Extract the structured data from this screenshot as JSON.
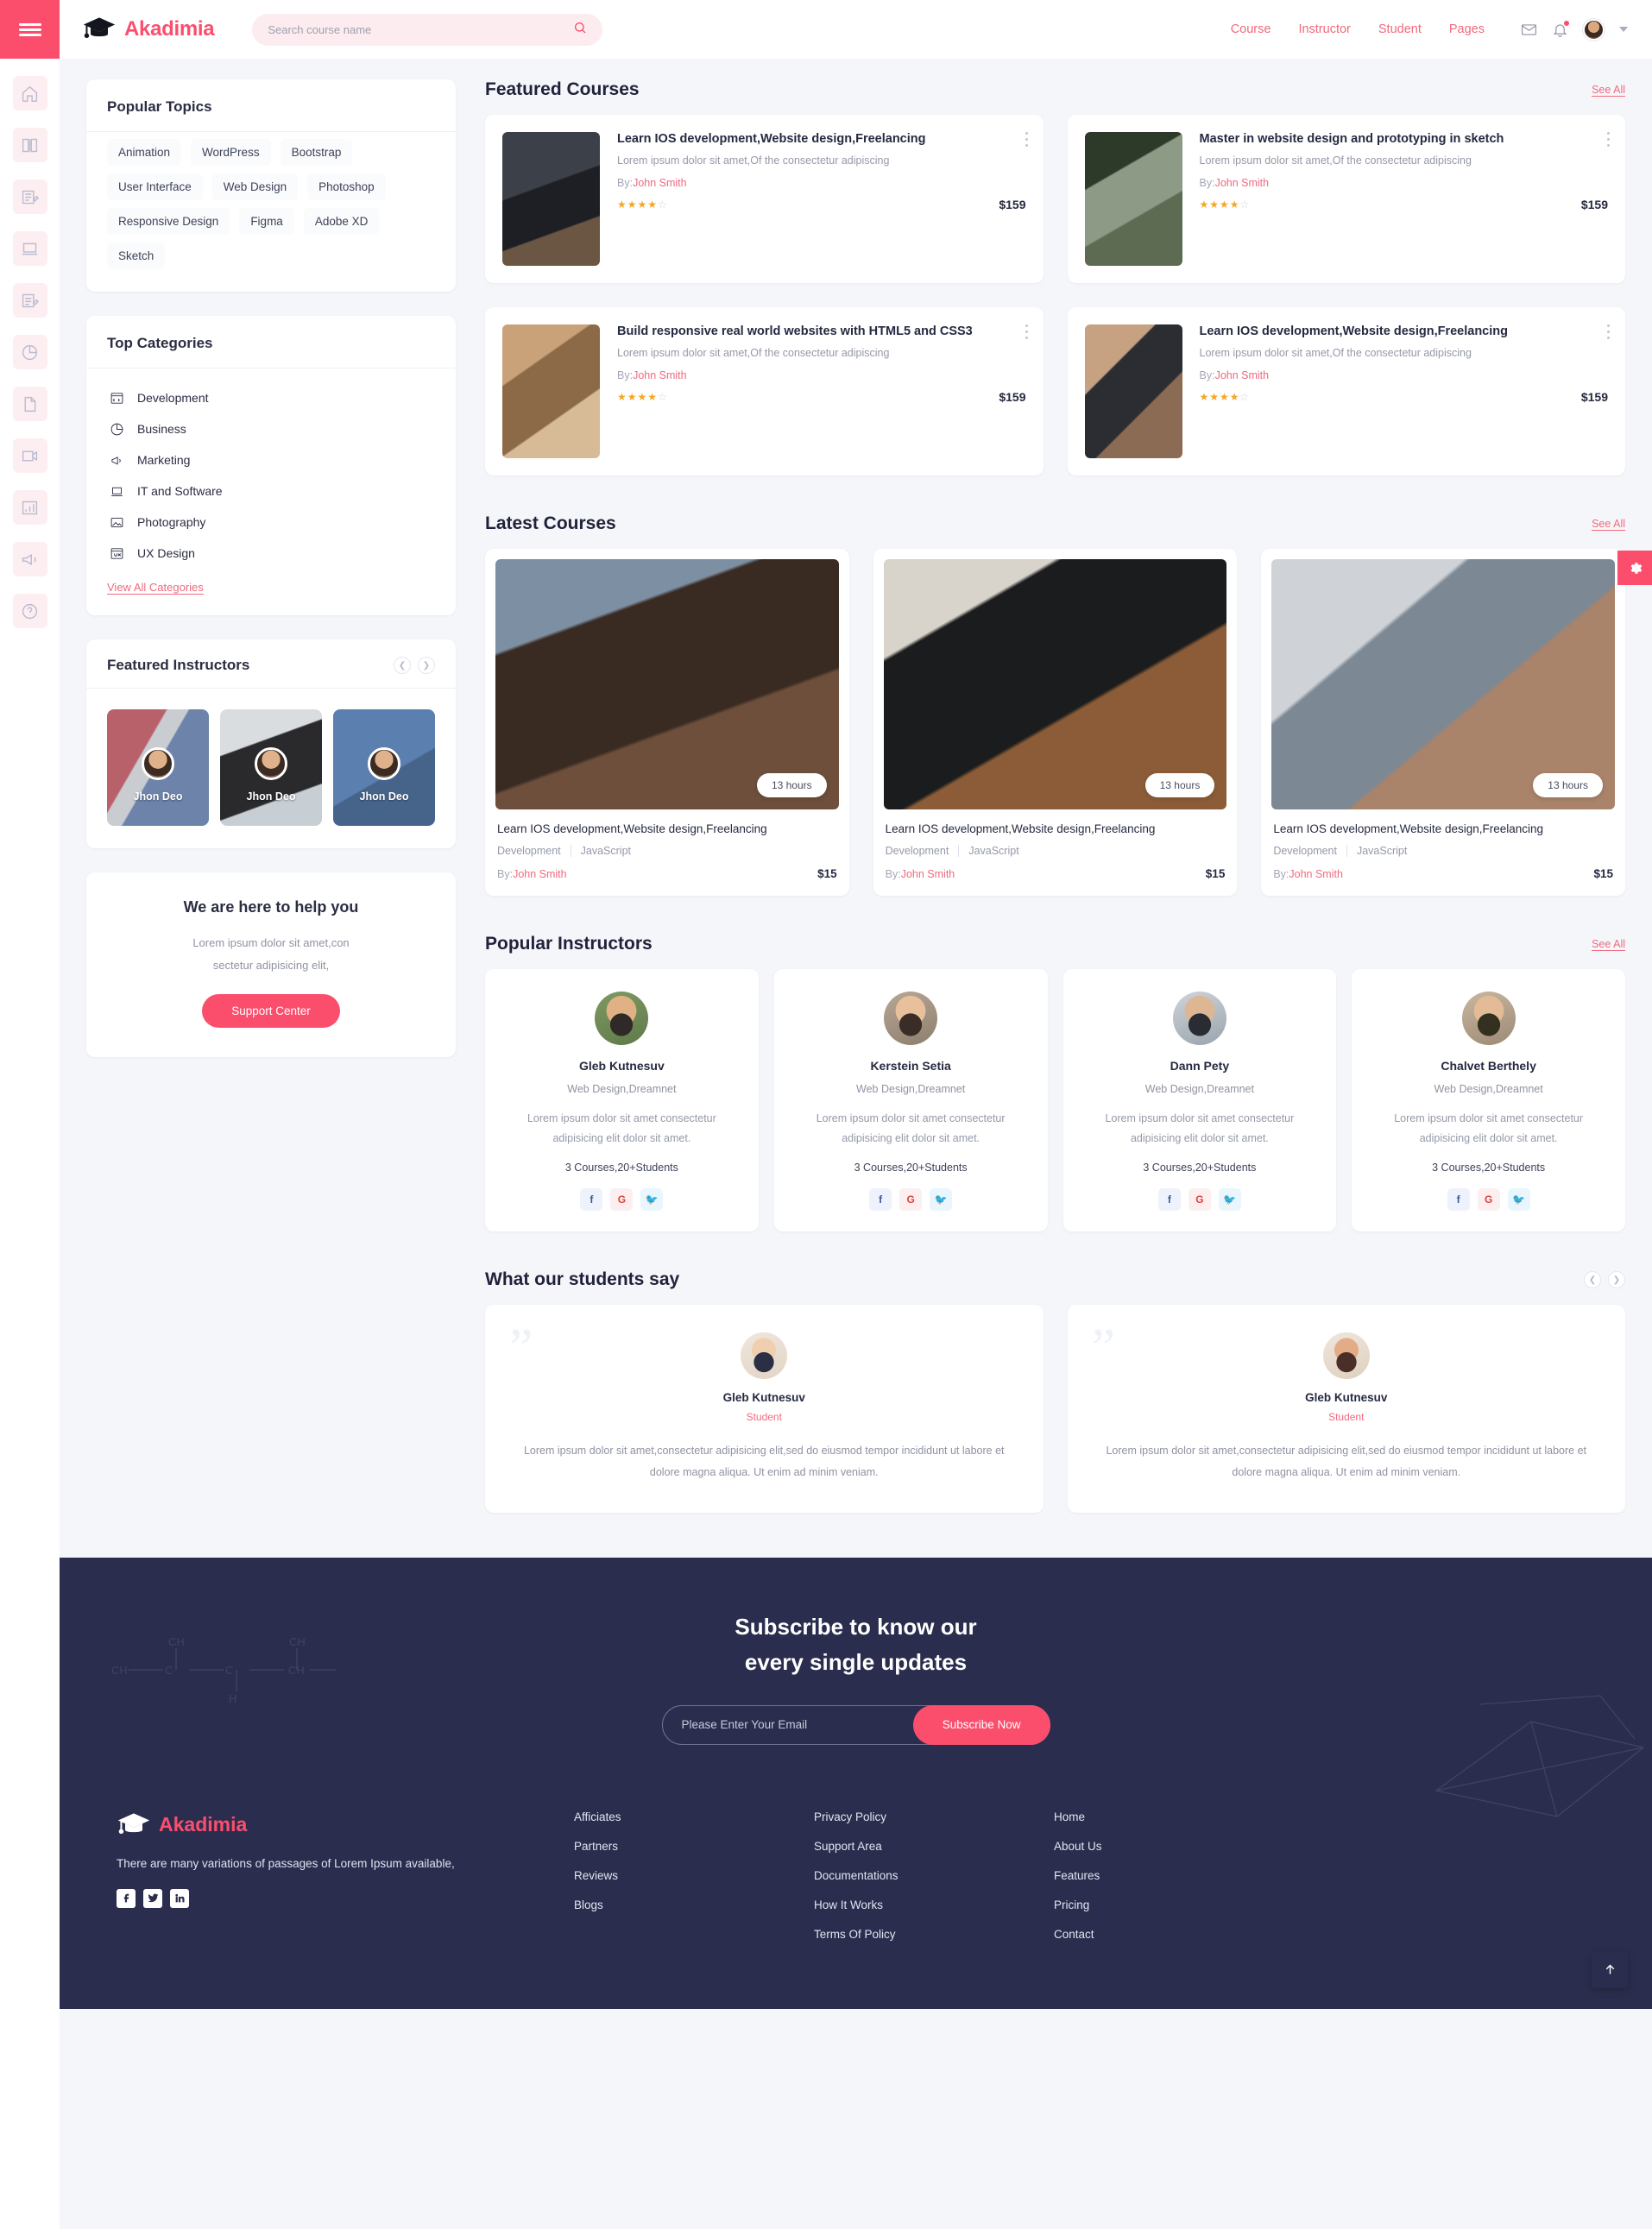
{
  "brand": {
    "name": "Akadimia",
    "logo_icon": "graduation-cap-icon"
  },
  "search": {
    "placeholder": "Search course name",
    "value": "",
    "icon": "search-icon"
  },
  "nav": {
    "links": [
      "Course",
      "Instructor",
      "Student",
      "Pages"
    ],
    "icons": [
      "mail-icon",
      "bell-icon",
      "avatar",
      "chevron-down-icon"
    ]
  },
  "rail": {
    "menu_icon": "hamburger-icon",
    "items": [
      "home-icon",
      "book-icon",
      "notes-icon",
      "laptop-icon",
      "assignment-icon",
      "chart-pie-icon",
      "file-icon",
      "video-icon",
      "report-icon",
      "megaphone-icon",
      "help-icon"
    ]
  },
  "sidebar": {
    "popular_topics": {
      "title": "Popular Topics",
      "chips": [
        "Animation",
        "WordPress",
        "Bootstrap",
        "User Interface",
        "Web Design",
        "Photoshop",
        "Responsive Design",
        "Figma",
        "Adobe XD",
        "Sketch"
      ]
    },
    "top_categories": {
      "title": "Top Categories",
      "items": [
        {
          "label": "Development",
          "icon": "window-code-icon"
        },
        {
          "label": "Business",
          "icon": "pie-chart-icon"
        },
        {
          "label": "Marketing",
          "icon": "megaphone-icon"
        },
        {
          "label": "IT and Software",
          "icon": "laptop-icon"
        },
        {
          "label": "Photography",
          "icon": "image-icon"
        },
        {
          "label": "UX Design",
          "icon": "ux-window-icon"
        }
      ],
      "view_all": "View All Categories"
    },
    "featured_instructors": {
      "title": "Featured Instructors",
      "prev_icon": "chevron-left-icon",
      "next_icon": "chevron-right-icon",
      "cards": [
        {
          "name": "Jhon Deo"
        },
        {
          "name": "Jhon Deo"
        },
        {
          "name": "Jhon Deo"
        }
      ]
    },
    "help": {
      "title": "We are here to help you",
      "line1": "Lorem ipsum dolor sit amet,con",
      "line2": "sectetur adipisicing elit,",
      "button": "Support Center"
    }
  },
  "main": {
    "featured": {
      "title": "Featured Courses",
      "see_all": "See All",
      "courses": [
        {
          "title": "Learn IOS development,Website design,Freelancing",
          "desc": "Lorem ipsum dolor sit amet,Of the consectetur adipiscing",
          "by_prefix": "By:",
          "author": "John Smith",
          "rating": 4,
          "price": "$159",
          "thumb": "t1"
        },
        {
          "title": "Master in website design and prototyping in sketch",
          "desc": "Lorem ipsum dolor sit amet,Of the consectetur adipiscing",
          "by_prefix": "By:",
          "author": "John Smith",
          "rating": 4,
          "price": "$159",
          "thumb": "t2"
        },
        {
          "title": "Build responsive real world websites with HTML5 and CSS3",
          "desc": "Lorem ipsum dolor sit amet,Of the consectetur adipiscing",
          "by_prefix": "By:",
          "author": "John Smith",
          "rating": 4,
          "price": "$159",
          "thumb": "t3"
        },
        {
          "title": "Learn IOS development,Website design,Freelancing",
          "desc": "Lorem ipsum dolor sit amet,Of the consectetur adipiscing",
          "by_prefix": "By:",
          "author": "John Smith",
          "rating": 4,
          "price": "$159",
          "thumb": "t4"
        }
      ]
    },
    "latest": {
      "title": "Latest Courses",
      "see_all": "See All",
      "courses": [
        {
          "duration": "13 hours",
          "title": "Learn IOS development,Website design,Freelancing",
          "tag1": "Development",
          "tag2": "JavaScript",
          "by_prefix": "By:",
          "author": "John Smith",
          "price": "$15",
          "img": "i1"
        },
        {
          "duration": "13 hours",
          "title": "Learn IOS development,Website design,Freelancing",
          "tag1": "Development",
          "tag2": "JavaScript",
          "by_prefix": "By:",
          "author": "John Smith",
          "price": "$15",
          "img": "i2"
        },
        {
          "duration": "13 hours",
          "title": "Learn IOS development,Website design,Freelancing",
          "tag1": "Development",
          "tag2": "JavaScript",
          "by_prefix": "By:",
          "author": "John Smith",
          "price": "$15",
          "img": "i3"
        }
      ]
    },
    "instructors": {
      "title": "Popular Instructors",
      "see_all": "See All",
      "cards": [
        {
          "name": "Gleb Kutnesuv",
          "role": "Web Design,Dreamnet",
          "bio": "Lorem ipsum dolor sit amet consectetur adipisicing elit dolor sit amet.",
          "stats": "3 Courses,20+Students",
          "avatar": "a1"
        },
        {
          "name": "Kerstein Setia",
          "role": "Web Design,Dreamnet",
          "bio": "Lorem ipsum dolor sit amet consectetur adipisicing elit dolor sit amet.",
          "stats": "3 Courses,20+Students",
          "avatar": "a2"
        },
        {
          "name": "Dann Pety",
          "role": "Web Design,Dreamnet",
          "bio": "Lorem ipsum dolor sit amet consectetur adipisicing elit dolor sit amet.",
          "stats": "3 Courses,20+Students",
          "avatar": "a3"
        },
        {
          "name": "Chalvet Berthely",
          "role": "Web Design,Dreamnet",
          "bio": "Lorem ipsum dolor sit amet consectetur adipisicing elit dolor sit amet.",
          "stats": "3 Courses,20+Students",
          "avatar": "a4"
        }
      ],
      "socials": [
        "facebook-icon",
        "google-icon",
        "twitter-icon"
      ]
    },
    "testimonials": {
      "title": "What our students say",
      "prev_icon": "chevron-left-icon",
      "next_icon": "chevron-right-icon",
      "cards": [
        {
          "name": "Gleb Kutnesuv",
          "role": "Student",
          "text": "Lorem ipsum dolor sit amet,consectetur adipisicing elit,sed do eiusmod tempor incididunt ut labore et dolore magna aliqua. Ut enim ad minim veniam.",
          "avatar": "t1"
        },
        {
          "name": "Gleb Kutnesuv",
          "role": "Student",
          "text": "Lorem ipsum dolor sit amet,consectetur adipisicing elit,sed do eiusmod tempor incididunt ut labore et dolore magna aliqua. Ut enim ad minim veniam.",
          "avatar": "t2"
        }
      ]
    }
  },
  "footer": {
    "subscribe": {
      "title_line1": "Subscribe to know our",
      "title_line2": "every single updates",
      "placeholder": "Please Enter Your Email",
      "value": "",
      "button": "Subscribe Now"
    },
    "brand": {
      "name": "Akadimia",
      "about": "There are many variations of passages of Lorem Ipsum available,"
    },
    "socials": [
      "facebook-icon",
      "twitter-icon",
      "linkedin-icon"
    ],
    "col1": [
      "Afficiates",
      "Partners",
      "Reviews",
      "Blogs"
    ],
    "col2": [
      "Privacy Policy",
      "Support Area",
      "Documentations",
      "How It Works",
      "Terms Of Policy"
    ],
    "col3": [
      "Home",
      "About Us",
      "Features",
      "Pricing",
      "Contact"
    ]
  },
  "floating": {
    "gear_icon": "gear-icon",
    "top_icon": "arrow-up-icon"
  },
  "colors": {
    "accent": "#fb4e6d",
    "accent_soft": "#f06a7e",
    "dark": "#2b2d4e",
    "page_bg": "#f5f6fa"
  }
}
